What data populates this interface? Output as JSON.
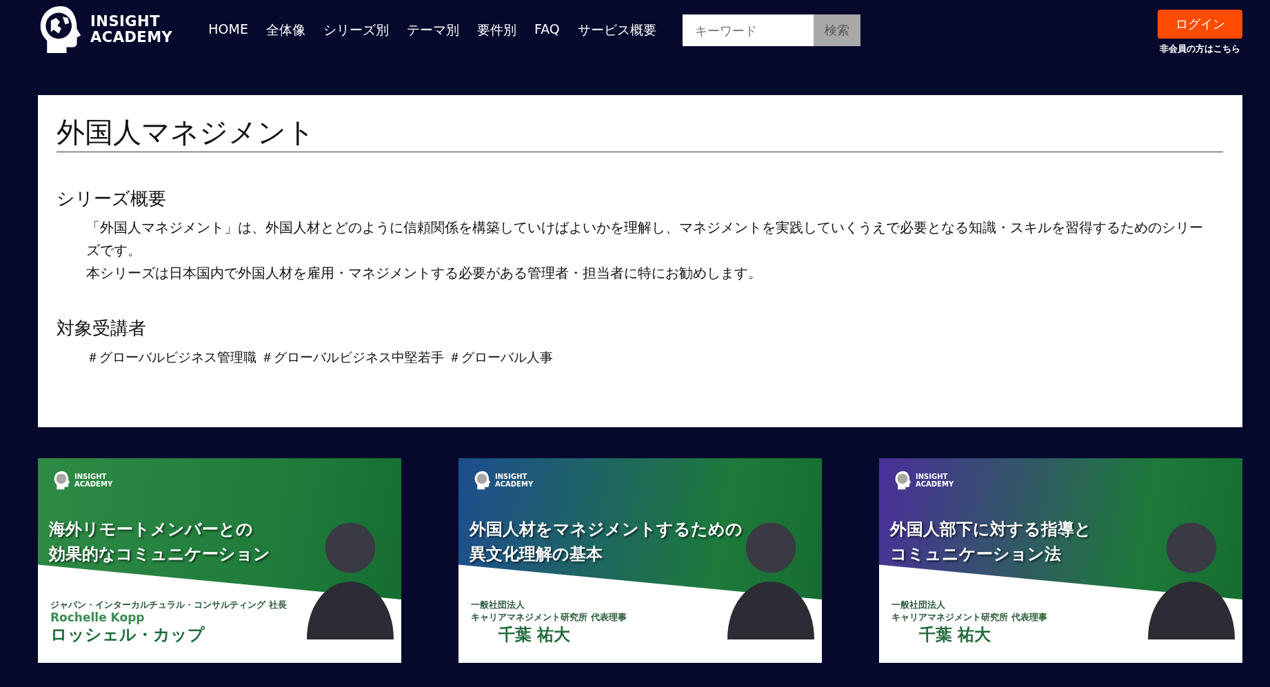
{
  "header": {
    "logo": {
      "line1": "INSIGHT",
      "line2": "ACADEMY"
    },
    "nav": [
      {
        "label": "HOME"
      },
      {
        "label": "全体像"
      },
      {
        "label": "シリーズ別"
      },
      {
        "label": "テーマ別"
      },
      {
        "label": "要件別"
      },
      {
        "label": "FAQ"
      },
      {
        "label": "サービス概要"
      }
    ],
    "search": {
      "placeholder": "キーワード",
      "button": "検索"
    },
    "login": {
      "button": "ログイン",
      "note": "非会員の方はこちら"
    }
  },
  "series": {
    "title": "外国人マネジメント",
    "sections": [
      {
        "kind": "paragraphs",
        "heading": "シリーズ概要",
        "paragraphs": [
          "「外国人マネジメント」は、外国人材とどのように信頼関係を構築していけばよいかを理解し、マネジメントを実践していくうえで必要となる知識・スキルを習得するためのシリーズです。",
          "本シリーズは日本国内で外国人材を雇用・マネジメントする必要がある管理者・担当者に特にお勧めします。"
        ]
      },
      {
        "kind": "tags",
        "heading": "対象受講者",
        "tags": [
          "＃グローバルビジネス管理職",
          "＃グローバルビジネス中堅若手",
          "＃グローバル人事"
        ]
      }
    ]
  },
  "courses": [
    {
      "logo": {
        "line1": "INSIGHT",
        "line2": "ACADEMY"
      },
      "title_lines": [
        "海外リモートメンバーとの",
        "効果的なコミュニケーション"
      ],
      "affiliation": [
        "ジャパン・インターカルチュラル・コンサルティング 社長"
      ],
      "name_latin": "Rochelle Kopp",
      "name": "ロッシェル・カップ",
      "color": "#2f8a45"
    },
    {
      "logo": {
        "line1": "INSIGHT",
        "line2": "ACADEMY"
      },
      "title_lines": [
        "外国人材をマネジメントするための",
        "異文化理解の基本"
      ],
      "affiliation": [
        "一般社団法人",
        "キャリアマネジメント研究所 代表理事"
      ],
      "name": "千葉 祐大",
      "color": "#1f4d8f"
    },
    {
      "logo": {
        "line1": "INSIGHT",
        "line2": "ACADEMY"
      },
      "title_lines": [
        "外国人部下に対する指導と",
        "コミュニケーション法"
      ],
      "affiliation": [
        "一般社団法人",
        "キャリアマネジメント研究所 代表理事"
      ],
      "name": "千葉 祐大",
      "color": "#4a2f9a"
    }
  ]
}
